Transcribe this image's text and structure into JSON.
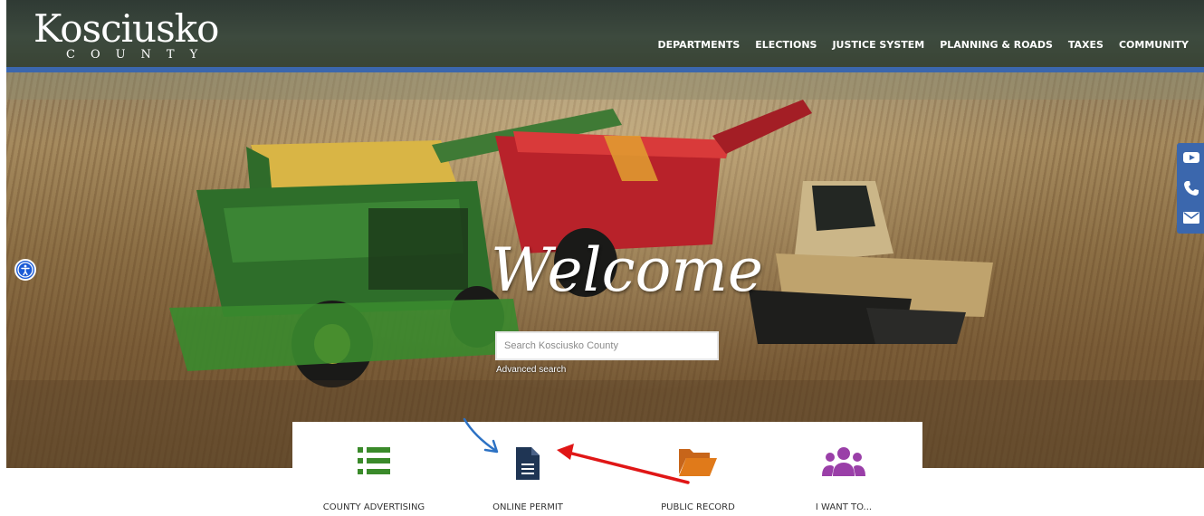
{
  "header": {
    "logo_word": "Kosciusko",
    "logo_sub": "COUNTY",
    "nav": [
      "DEPARTMENTS",
      "ELECTIONS",
      "JUSTICE SYSTEM",
      "PLANNING & ROADS",
      "TAXES",
      "COMMUNITY"
    ]
  },
  "hero": {
    "welcome": "Welcome",
    "search_placeholder": "Search Kosciusko County",
    "advanced_search": "Advanced search"
  },
  "social": [
    "youtube-icon",
    "phone-icon",
    "email-icon"
  ],
  "quick_links": [
    {
      "label": "COUNTY ADVERTISING",
      "icon": "list-icon",
      "color": "#3a8a2a"
    },
    {
      "label": "ONLINE PERMIT",
      "icon": "document-icon",
      "color": "#1f3554"
    },
    {
      "label": "PUBLIC RECORD",
      "icon": "folder-open-icon",
      "color": "#e07a1a"
    },
    {
      "label": "I WANT TO...",
      "icon": "users-icon",
      "color": "#9a3fa8"
    }
  ],
  "colors": {
    "header_stripe": "#3b67ad",
    "annotation_red": "#e01616",
    "annotation_blue": "#2d72c4"
  }
}
